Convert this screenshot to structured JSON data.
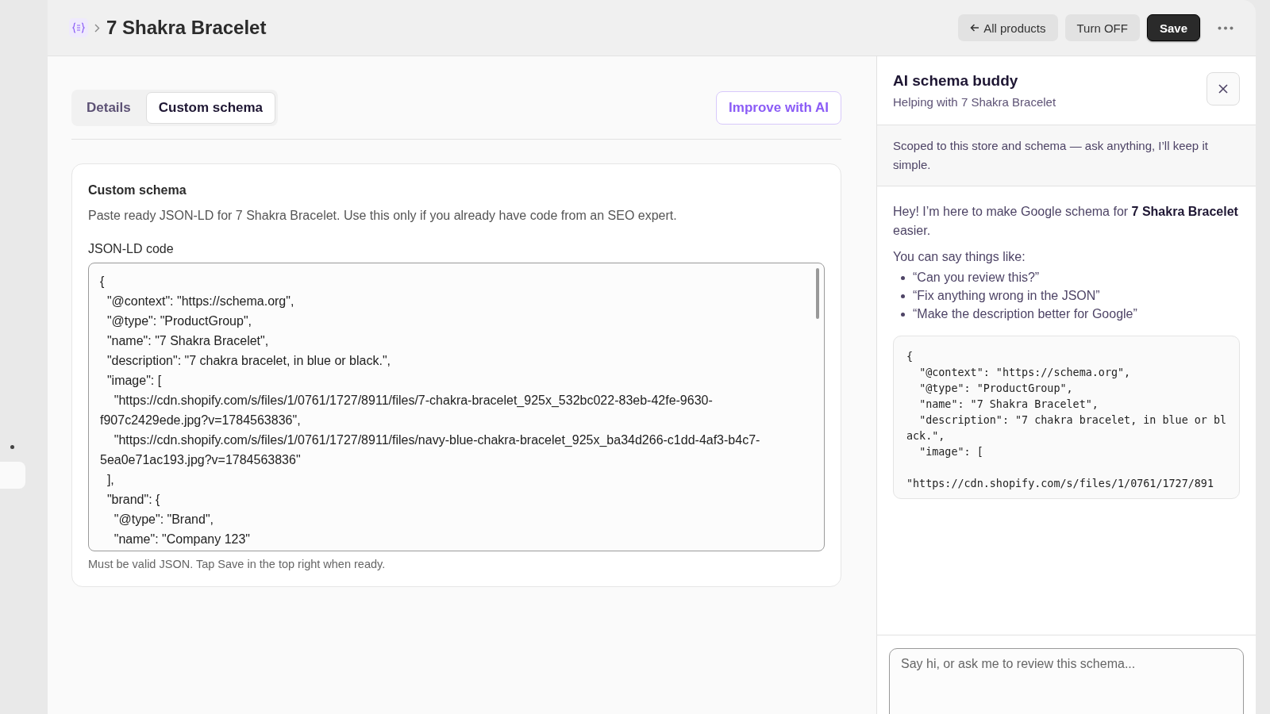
{
  "breadcrumb": {
    "title": "7 Shakra Bracelet"
  },
  "header_actions": [
    {
      "label": "All products",
      "kind": "back"
    },
    {
      "label": "Turn OFF",
      "kind": "secondary"
    },
    {
      "label": "Save",
      "kind": "primary"
    }
  ],
  "tabs": [
    {
      "label": "Details",
      "selected": false
    },
    {
      "label": "Custom schema",
      "selected": true
    }
  ],
  "improve_button": "Improve with AI",
  "card": {
    "title": "Custom schema",
    "description": "Paste ready JSON-LD for 7 Shakra Bracelet. Use this only if you already have code from an SEO expert.",
    "field_label": "JSON-LD code",
    "code": "{\n  \"@context\": \"https://schema.org\",\n  \"@type\": \"ProductGroup\",\n  \"name\": \"7 Shakra Bracelet\",\n  \"description\": \"7 chakra bracelet, in blue or black.\",\n  \"image\": [\n    \"https://cdn.shopify.com/s/files/1/0761/1727/8911/files/7-chakra-bracelet_925x_532bc022-83eb-42fe-9630-f907c2429ede.jpg?v=1784563836\",\n    \"https://cdn.shopify.com/s/files/1/0761/1727/8911/files/navy-blue-chakra-bracelet_925x_ba34d266-c1dd-4af3-b4c7-5ea0e71ac193.jpg?v=1784563836\"\n  ],\n  \"brand\": {\n    \"@type\": \"Brand\",\n    \"name\": \"Company 123\"",
    "hint": "Must be valid JSON. Tap Save in the top right when ready."
  },
  "assistant": {
    "title": "AI schema buddy",
    "subtitle": "Helping with 7 Shakra Bracelet",
    "notice": "Scoped to this store and schema — ask anything, I’ll keep it simple.",
    "message": "Hey! I’m here to make Google schema for **7 Shakra Bracelet** easier.",
    "suggestions_intro": "You can say things like:",
    "suggestions": [
      "“Can you review this?”",
      "“Fix anything wrong in the JSON”",
      "“Make the description better for Google”"
    ],
    "code": "{\n  \"@context\": \"https://schema.org\",\n  \"@type\": \"ProductGroup\",\n  \"name\": \"7 Shakra Bracelet\",\n  \"description\": \"7 chakra bracelet, in blue or black.\",\n  \"image\": [\n\n\"https://cdn.shopify.com/s/files/1/0761/1727/891",
    "input": {
      "placeholder": "Say hi, or ask me to review this schema..."
    }
  }
}
